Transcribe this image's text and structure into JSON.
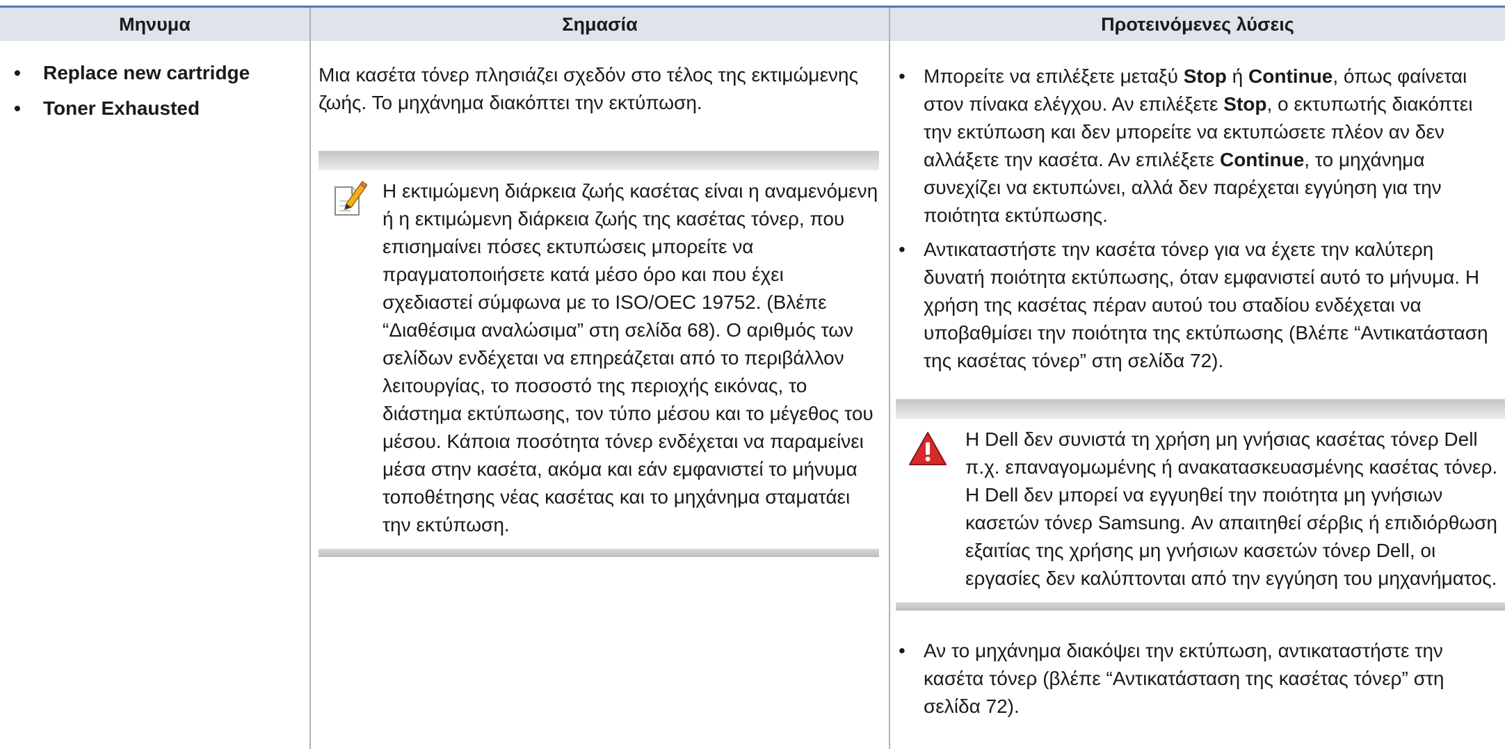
{
  "table": {
    "headers": [
      "Μηνυμα",
      "Σημασία",
      "Προτεινόμενες λύσεις"
    ]
  },
  "messages": [
    "Replace new cartridge",
    "Toner Exhausted"
  ],
  "meaning": {
    "text": "Μια κασέτα τόνερ πλησιάζει σχεδόν στο τέλος της εκτιμώμενης ζωής. Το μηχάνημα διακόπτει την εκτύπωση.",
    "note_icon": "note-pencil-icon",
    "note": "Η εκτιμώμενη διάρκεια ζωής κασέτας είναι η αναμενόμενη ή η εκτιμώμενη διάρκεια ζωής της κασέτας τόνερ, που επισημαίνει πόσες εκτυπώσεις μπορείτε να πραγματοποιήσετε κατά μέσο όρο και που έχει σχεδιαστεί σύμφωνα με το ISO/OEC 19752. (Βλέπε “Διαθέσιμα αναλώσιμα” στη σελίδα 68). Ο αριθμός των σελίδων ενδέχεται να επηρεάζεται από το περιβάλλον λειτουργίας, το ποσοστό της περιοχής εικόνας, το διάστημα εκτύπωσης, τον τύπο μέσου και το μέγεθος του μέσου. Κάποια ποσότητα τόνερ ενδέχεται να παραμείνει μέσα στην κασέτα, ακόμα και εάν εμφανιστεί το μήνυμα τοποθέτησης νέας κασέτας και το μηχάνημα σταματάει την εκτύπωση."
  },
  "solutions": {
    "item1": {
      "a": "Μπορείτε να επιλέξετε μεταξύ ",
      "stop": "Stop",
      "b": " ή ",
      "continue": "Continue",
      "c": ", όπως φαίνεται στον πίνακα ελέγχου. Αν επιλέξετε ",
      "stop2": "Stop",
      "d": ", ο εκτυπωτής διακόπτει την εκτύπωση και δεν μπορείτε να εκτυπώσετε πλέον αν δεν αλλάξετε την κασέτα. Αν επιλέξετε ",
      "continue2": "Continue",
      "e": ", το μηχάνημα συνεχίζει να εκτυπώνει, αλλά δεν παρέχεται εγγύηση για την ποιότητα εκτύπωσης."
    },
    "item2": "Αντικαταστήστε την κασέτα τόνερ για να έχετε την καλύτερη δυνατή ποιότητα εκτύπωσης, όταν εμφανιστεί αυτό το μήνυμα. Η χρήση της κασέτας πέραν αυτού του σταδίου ενδέχεται να υποβαθμίσει την ποιότητα της εκτύπωσης (Βλέπε “Αντικατάσταση της κασέτας τόνερ” στη σελίδα 72).",
    "warning_icon": "warning-icon",
    "warning": "Η Dell δεν συνιστά τη χρήση μη γνήσιας κασέτας τόνερ Dell π.χ. επαναγομωμένης ή ανακατασκευασμένης κασέτας τόνερ. Η Dell δεν μπορεί να εγγυηθεί την ποιότητα μη γνήσιων κασετών τόνερ Samsung. Αν απαιτηθεί σέρβις ή επιδιόρθωση εξαιτίας της χρήσης μη γνήσιων κασετών τόνερ Dell, οι εργασίες δεν καλύπτονται από την εγγύηση του μηχανήματος.",
    "item3": "Αν το μηχάνημα διακόψει την εκτύπωση, αντικαταστήστε την κασέτα τόνερ (βλέπε “Αντικατάσταση της κασέτας τόνερ” στη σελίδα 72)."
  }
}
